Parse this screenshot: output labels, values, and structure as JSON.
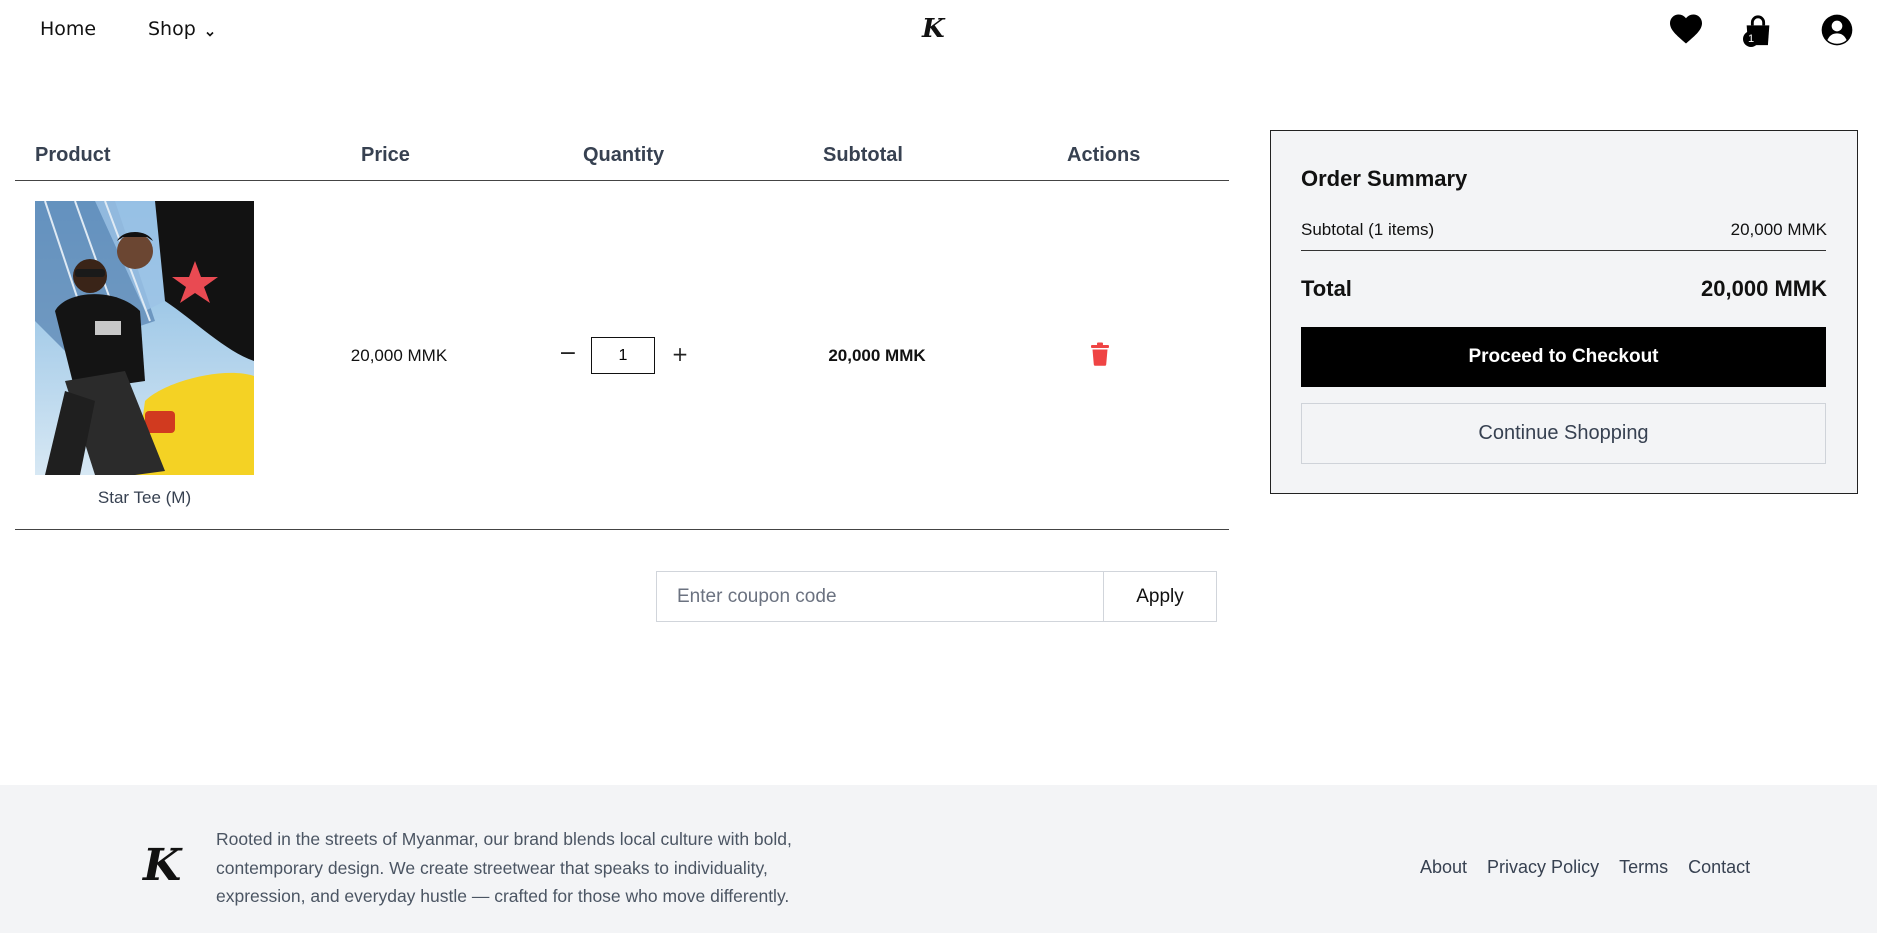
{
  "header": {
    "nav_home": "Home",
    "nav_shop": "Shop",
    "logo": "K",
    "cart_count": "1"
  },
  "table": {
    "headers": [
      "Product",
      "Price",
      "Quantity",
      "Subtotal",
      "Actions"
    ],
    "rows": [
      {
        "product_name": "Star Tee (M)",
        "price": "20,000 MMK",
        "quantity": "1",
        "subtotal": "20,000 MMK"
      }
    ]
  },
  "coupon": {
    "placeholder": "Enter coupon code",
    "apply_label": "Apply"
  },
  "summary": {
    "title": "Order Summary",
    "subtotal_label": "Subtotal (1 items)",
    "subtotal_value": "20,000 MMK",
    "total_label": "Total",
    "total_value": "20,000 MMK",
    "checkout_label": "Proceed to Checkout",
    "continue_label": "Continue Shopping"
  },
  "footer": {
    "logo": "K",
    "description": "Rooted in the streets of Myanmar, our brand blends local culture with bold, contemporary design. We create streetwear that speaks to individuality, expression, and everyday hustle — crafted for those who move differently.",
    "links": [
      "About",
      "Privacy Policy",
      "Terms",
      "Contact"
    ]
  },
  "colors": {
    "delete_icon": "#ef4444",
    "checkout_bg": "#000000",
    "summary_bg": "#f3f4f6",
    "footer_bg": "#f3f4f6"
  },
  "icons": [
    "chevron-down-icon",
    "heart-icon",
    "shopping-bag-icon",
    "user-circle-icon",
    "trash-icon"
  ]
}
